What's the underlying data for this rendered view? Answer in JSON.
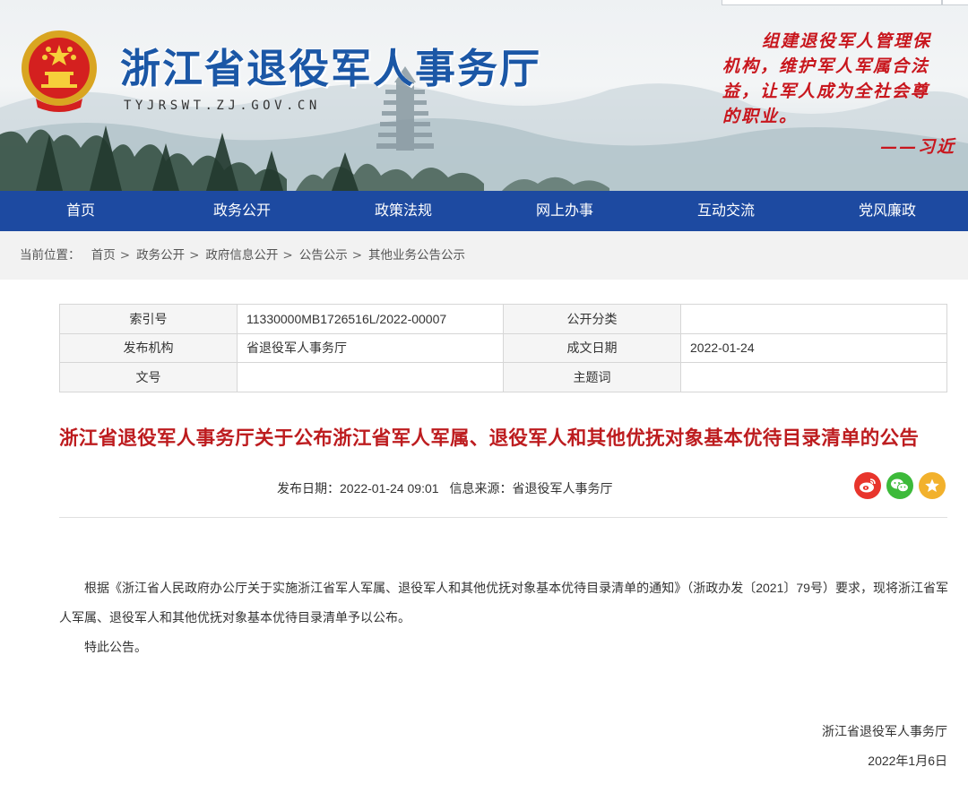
{
  "header": {
    "site_title": "浙江省退役军人事务厅",
    "domain": "TYJRSWT.ZJ.GOV.CN",
    "quote_lines": [
      "组建退役军人管理保",
      "机构，维护军人军属合法",
      "益，让军人成为全社会尊",
      "的职业。"
    ],
    "quote_signature": "——习近"
  },
  "nav": {
    "items": [
      "首页",
      "政务公开",
      "政策法规",
      "网上办事",
      "互动交流",
      "党风廉政"
    ]
  },
  "breadcrumb": {
    "label": "当前位置：",
    "items": [
      "首页",
      "政务公开",
      "政府信息公开",
      "公告公示",
      "其他业务公告公示"
    ],
    "separator": ">"
  },
  "info_table": {
    "index_label": "索引号",
    "index_value": "11330000MB1726516L/2022-00007",
    "category_label": "公开分类",
    "category_value": "",
    "publisher_label": "发布机构",
    "publisher_value": "省退役军人事务厅",
    "date_label": "成文日期",
    "date_value": "2022-01-24",
    "docno_label": "文号",
    "docno_value": "",
    "keyword_label": "主题词",
    "keyword_value": ""
  },
  "article": {
    "title": "浙江省退役军人事务厅关于公布浙江省军人军属、退役军人和其他优抚对象基本优待目录清单的公告",
    "publish_label": "发布日期：",
    "publish_value": "2022-01-24 09:01",
    "source_label": "信息来源：",
    "source_value": "省退役军人事务厅",
    "paragraph1": "根据《浙江省人民政府办公厅关于实施浙江省军人军属、退役军人和其他优抚对象基本优待目录清单的通知》（浙政办发〔2021〕79号）要求，现将浙江省军人军属、退役军人和其他优抚对象基本优待目录清单予以公布。",
    "paragraph2": "特此公告。",
    "signature_org": "浙江省退役军人事务厅",
    "signature_date": "2022年1月6日"
  },
  "share": {
    "icons": [
      "weibo-icon",
      "wechat-icon",
      "favorite-icon"
    ]
  },
  "colors": {
    "nav_bg": "#1d4aa1",
    "title_blue": "#1b57a6",
    "article_title_red": "#bd1c1f",
    "weibo": "#e8352c",
    "wechat": "#3dba3a",
    "favorite": "#f2b12c"
  }
}
